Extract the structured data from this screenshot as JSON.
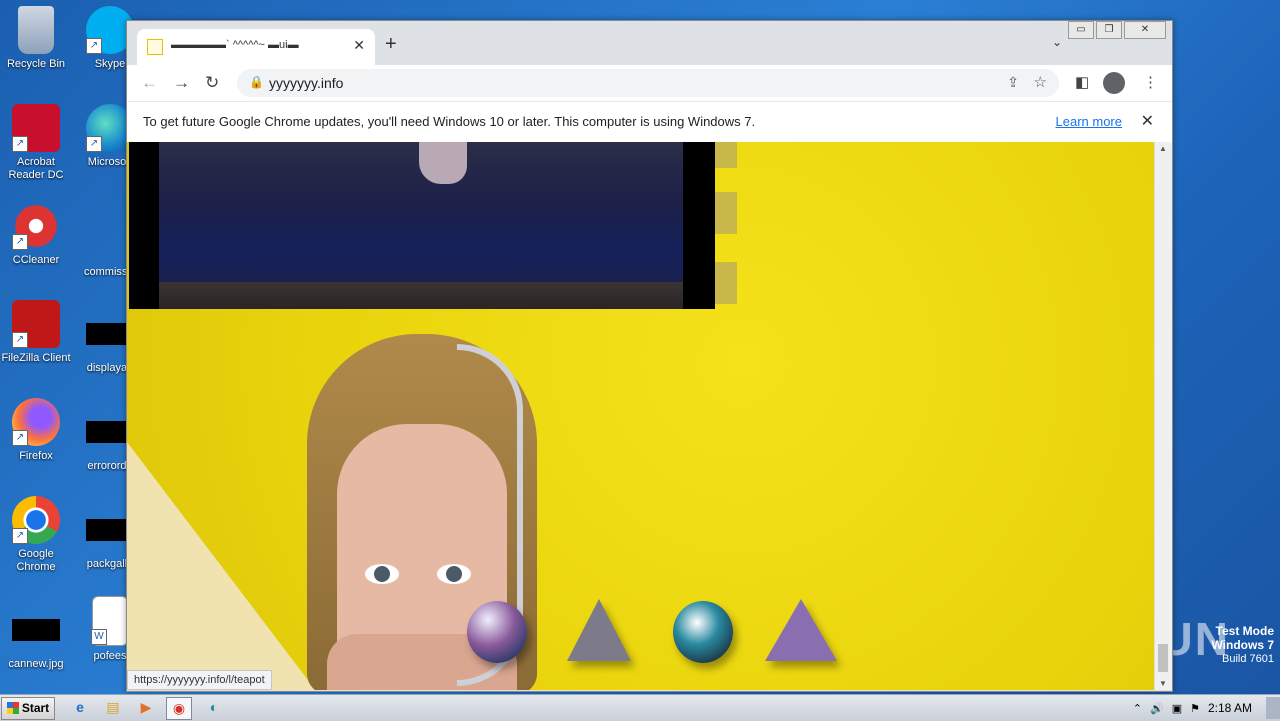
{
  "desktop": {
    "icons_col1": [
      {
        "label": "Recycle Bin",
        "icon": "recycle-bin-icon"
      },
      {
        "label": "Acrobat Reader DC",
        "icon": "acrobat-icon"
      },
      {
        "label": "CCleaner",
        "icon": "ccleaner-icon"
      },
      {
        "label": "FileZilla Client",
        "icon": "filezilla-icon"
      },
      {
        "label": "Firefox",
        "icon": "firefox-icon"
      },
      {
        "label": "Google Chrome",
        "icon": "chrome-icon"
      },
      {
        "label": "cannew.jpg",
        "icon": "image-file-icon"
      }
    ],
    "icons_col2": [
      {
        "label": "Skype",
        "icon": "skype-icon"
      },
      {
        "label": "Microsoft",
        "icon": "edge-icon"
      },
      {
        "label": "commissio",
        "icon": "file-icon"
      },
      {
        "label": "displayau",
        "icon": "file-icon"
      },
      {
        "label": "errororde",
        "icon": "file-icon"
      },
      {
        "label": "packgalle",
        "icon": "file-icon"
      },
      {
        "label": "pofees",
        "icon": "word-icon"
      }
    ],
    "watermark": "ANY RUN",
    "test_mode": {
      "line1": "Test Mode",
      "line2": "Windows 7",
      "line3": "Build 7601"
    }
  },
  "browser": {
    "tab": {
      "title": "▬▬▬▬▬` ^^^^^~ ▬ui▬",
      "close": "✕"
    },
    "new_tab": "+",
    "tab_dropdown": "⌄",
    "window_controls": {
      "minimize": "▭",
      "restore": "❐",
      "close": "✕"
    },
    "nav": {
      "back": "←",
      "forward": "→",
      "reload": "↻"
    },
    "address": {
      "lock": "🔒",
      "url": "yyyyyyy.info",
      "share": "⇪",
      "bookmark": "☆"
    },
    "side_panel": "◧",
    "menu": "⋮",
    "infobar": {
      "message": "To get future Google Chrome updates, you'll need Windows 10 or later. This computer is using Windows 7.",
      "link": "Learn more",
      "close": "✕"
    },
    "status_url": "https://yyyyyyy.info/l/teapot"
  },
  "taskbar": {
    "start": "Start",
    "apps": [
      {
        "name": "ie-icon",
        "glyph": "e",
        "color": "#1e6fd0"
      },
      {
        "name": "explorer-icon",
        "glyph": "▤",
        "color": "#d9a32a"
      },
      {
        "name": "media-player-icon",
        "glyph": "▶",
        "color": "#e0702a"
      },
      {
        "name": "chrome-icon",
        "glyph": "◉",
        "color": "#d93025"
      },
      {
        "name": "edge-icon",
        "glyph": "◐",
        "color": "#1a8a9a"
      }
    ],
    "tray": {
      "chevron": "⌃",
      "volume": "🔊",
      "network": "▣",
      "flag": "⚑",
      "time": "2:18 AM"
    }
  }
}
